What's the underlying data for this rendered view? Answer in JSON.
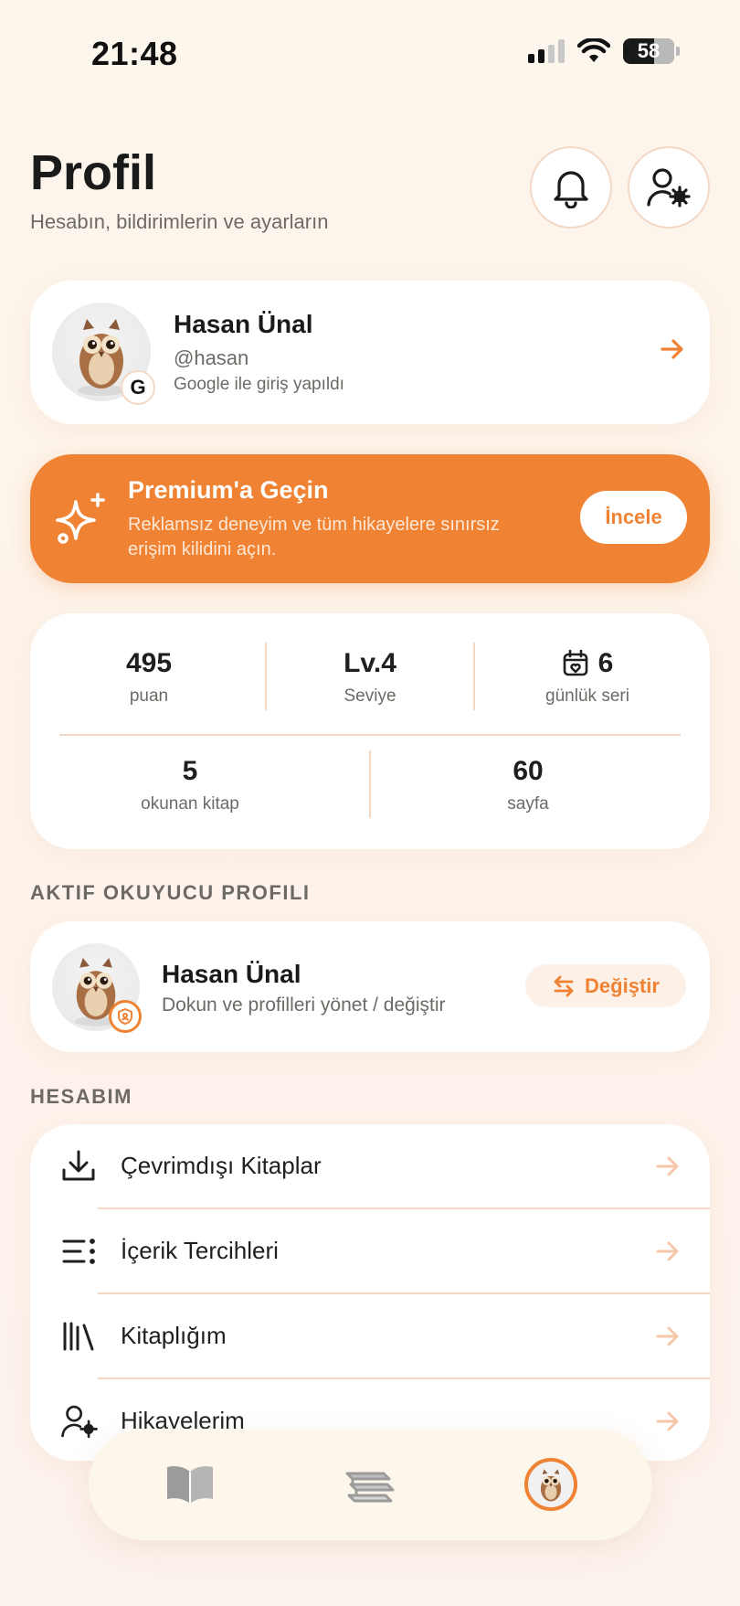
{
  "status_bar": {
    "time": "21:48",
    "battery": "58"
  },
  "header": {
    "title": "Profil",
    "subtitle": "Hesabın, bildirimlerin ve ayarların"
  },
  "profile": {
    "name": "Hasan Ünal",
    "handle": "@hasan",
    "login_method": "Google ile giriş yapıldı",
    "badge_letter": "G"
  },
  "premium": {
    "title": "Premium'a Geçin",
    "description": "Reklamsız deneyim ve tüm hikayelere sınırsız erişim kilidini açın.",
    "button": "İncele"
  },
  "stats": {
    "points": {
      "value": "495",
      "label": "puan"
    },
    "level": {
      "value": "Lv.4",
      "label": "Seviye"
    },
    "streak": {
      "value": "6",
      "label": "günlük seri"
    },
    "books": {
      "value": "5",
      "label": "okunan kitap"
    },
    "pages": {
      "value": "60",
      "label": "sayfa"
    }
  },
  "active_reader": {
    "section_label": "AKTIF OKUYUCU PROFILI",
    "name": "Hasan Ünal",
    "description": "Dokun ve profilleri yönet / değiştir",
    "switch_button": "Değiştir"
  },
  "account": {
    "section_label": "HESABIM",
    "items": [
      {
        "label": "Çevrimdışı Kitaplar",
        "icon": "download-icon"
      },
      {
        "label": "İçerik Tercihleri",
        "icon": "list-settings-icon"
      },
      {
        "label": "Kitaplığım",
        "icon": "library-icon"
      },
      {
        "label": "Hikayelerim",
        "icon": "user-gear-icon"
      }
    ]
  },
  "tabbar": {
    "tabs": [
      {
        "icon": "open-book-icon",
        "active": false
      },
      {
        "icon": "books-stack-icon",
        "active": false
      },
      {
        "icon": "profile-avatar-icon",
        "active": true
      }
    ]
  },
  "colors": {
    "accent": "#ef8233",
    "background": "#fdf6ec",
    "divider": "#f3d8c6",
    "muted_text": "#6d6a66"
  }
}
